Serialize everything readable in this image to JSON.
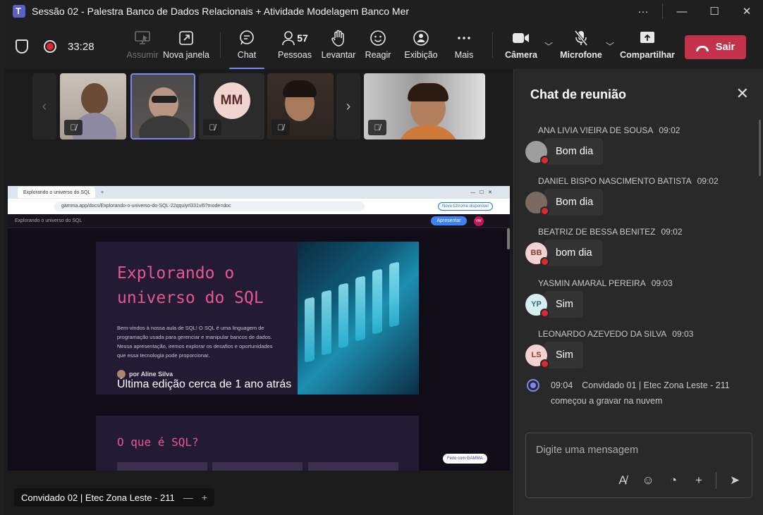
{
  "window": {
    "title": "Sessão 02 - Palestra Banco de Dados Relacionais + Atividade Modelagem Banco Mer",
    "more_glyph": "···",
    "minimize_glyph": "—",
    "maximize_glyph": "☐",
    "close_glyph": "✕"
  },
  "toolbar": {
    "timer": "33:28",
    "buttons": {
      "assumir": "Assumir",
      "nova_janela": "Nova janela",
      "chat": "Chat",
      "pessoas": "Pessoas",
      "pessoas_count": "57",
      "levantar": "Levantar",
      "reagir": "Reagir",
      "exibicao": "Exibição",
      "mais": "Mais",
      "camera": "Câmera",
      "microfone": "Microfone",
      "compartilhar": "Compartilhar",
      "sair": "Sair"
    }
  },
  "participants": {
    "mm_initials": "MM"
  },
  "shared_screen": {
    "tab_title": "Explorando o universo do SQL",
    "url": "gamma.app/docs/Explorando-o-universo-do-SQL-22qquiyrl331vi5?mode=doc",
    "chrome_notice": "Novo Chrome disponível",
    "doc_title": "Explorando o universo do SQL",
    "present_button": "Apresentar",
    "user_initials": "VW",
    "card_title": "Explorando o universo do SQL",
    "card_body": "Bem-vindos à nossa aula de SQL! O SQL é uma linguagem de programação usada para gerenciar e manipular bancos de dados. Nessa apresentação, iremos explorar os desafios e oportunidades que essa tecnologia pode proporcionar.",
    "author": "por Aline Silva",
    "edited": "Última edição cerca de 1 ano atrás",
    "section_title": "O que é SQL?",
    "made_with": "Feito com GAMMA"
  },
  "presenter_label": "Convidado 02 | Etec Zona Leste - 211",
  "chat": {
    "title": "Chat de reunião",
    "messages": [
      {
        "name": "ANA LIVIA VIEIRA DE SOUSA",
        "time": "09:02",
        "text": "Bom dia",
        "initials": "",
        "avatar_color": "#9e9e9e"
      },
      {
        "name": "DANIEL BISPO NASCIMENTO BATISTA",
        "time": "09:02",
        "text": "Bom dia",
        "initials": "",
        "avatar_color": "#7a6a62"
      },
      {
        "name": "BEATRIZ DE BESSA BENITEZ",
        "time": "09:02",
        "text": "bom dia",
        "initials": "BB",
        "avatar_color": "#f1d4d0"
      },
      {
        "name": "YASMIN AMARAL PEREIRA",
        "time": "09:03",
        "text": "Sim",
        "initials": "YP",
        "avatar_color": "#d6eef0"
      },
      {
        "name": "LEONARDO AZEVEDO DA SILVA",
        "time": "09:03",
        "text": "Sim",
        "initials": "LS",
        "avatar_color": "#f1d4d0"
      }
    ],
    "system": {
      "time": "09:04",
      "text1": "Convidado 01 | Etec Zona Leste - 211",
      "text2": "começou a gravar na nuvem"
    },
    "placeholder": "Digite uma mensagem"
  }
}
